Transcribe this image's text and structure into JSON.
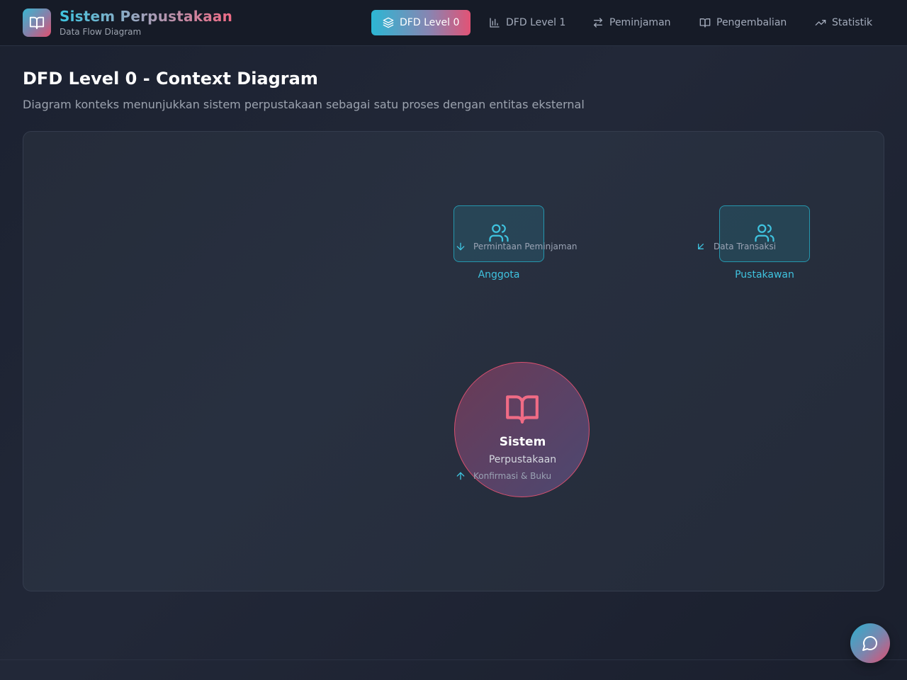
{
  "brand": {
    "title": "Sistem Perpustakaan",
    "subtitle": "Data Flow Diagram",
    "logo_icon": "book-open-icon"
  },
  "nav": {
    "items": [
      {
        "label": "DFD Level 0",
        "icon": "layers-icon",
        "active": true
      },
      {
        "label": "DFD Level 1",
        "icon": "bar-chart-icon",
        "active": false
      },
      {
        "label": "Peminjaman",
        "icon": "arrows-left-right-icon",
        "active": false
      },
      {
        "label": "Pengembalian",
        "icon": "book-open-icon",
        "active": false
      },
      {
        "label": "Statistik",
        "icon": "trending-up-icon",
        "active": false
      }
    ]
  },
  "page": {
    "title": "DFD Level 0 - Context Diagram",
    "description": "Diagram konteks menunjukkan sistem perpustakaan sebagai satu proses dengan entitas eksternal"
  },
  "diagram": {
    "entities": [
      {
        "label": "Anggota",
        "icon": "users-icon"
      },
      {
        "label": "Pustakawan",
        "icon": "users-icon"
      }
    ],
    "process": {
      "title": "Sistem",
      "subtitle": "Perpustakaan",
      "icon": "book-open-icon"
    },
    "flows": [
      {
        "label": "Permintaan Peminjaman",
        "icon": "arrow-down-icon"
      },
      {
        "label": "Data Transaksi",
        "icon": "arrow-down-left-icon"
      },
      {
        "label": "Konfirmasi & Buku",
        "icon": "arrow-up-icon"
      }
    ]
  },
  "chat": {
    "icon": "chat-bubble-icon"
  },
  "colors": {
    "accent_cyan": "#3fc3df",
    "accent_pink": "#e0506e",
    "background": "#1b2130",
    "entity_border": "#2596ad",
    "process_border": "#d9506f"
  }
}
